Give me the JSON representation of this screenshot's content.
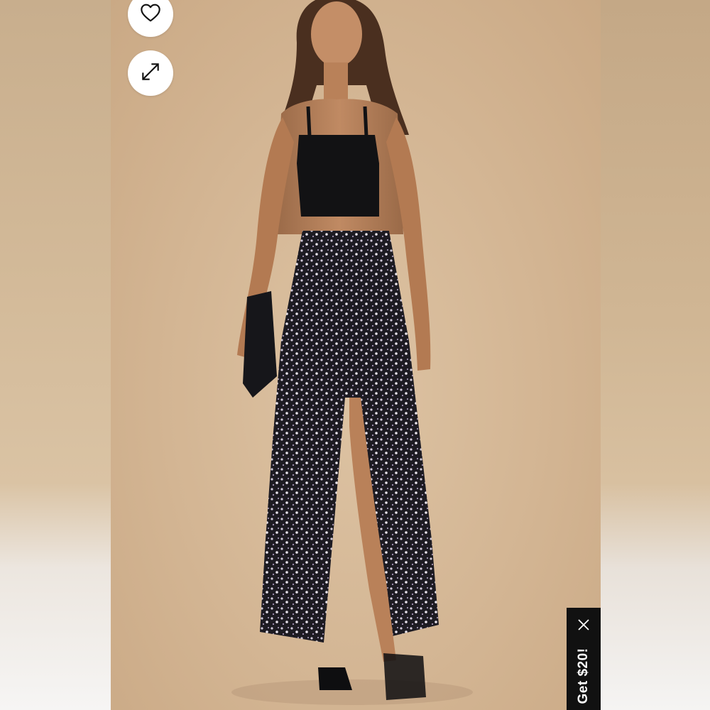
{
  "overlay": {
    "like_icon": "heart-outline-icon",
    "expand_icon": "expand-arrows-icon"
  },
  "promo": {
    "label": "Get $20!",
    "close_icon": "close-x-icon"
  },
  "colors": {
    "backdrop": "#d3b593",
    "button_bg": "#ffffff",
    "promo_bg": "#111111",
    "promo_text": "#ffffff"
  }
}
